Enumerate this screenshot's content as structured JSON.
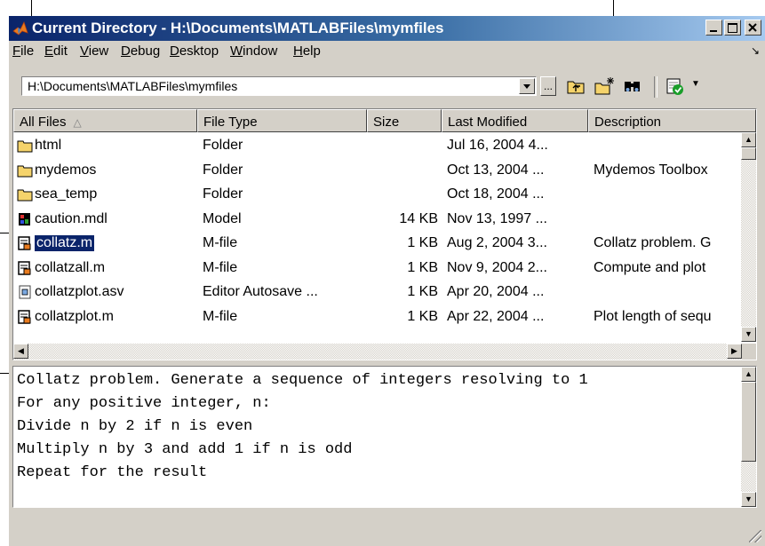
{
  "window": {
    "title": "Current Directory - H:\\Documents\\MATLABFiles\\mymfiles"
  },
  "menu": [
    "File",
    "Edit",
    "View",
    "Debug",
    "Desktop",
    "Window",
    "Help"
  ],
  "toolbar": {
    "path": "H:\\Documents\\MATLABFiles\\mymfiles",
    "browse_label": "...",
    "icons": [
      "up-folder-icon",
      "new-folder-icon",
      "find-files-icon",
      "report-icon"
    ]
  },
  "columns": [
    "All Files",
    "File Type",
    "Size",
    "Last Modified",
    "Description"
  ],
  "files": [
    {
      "name": "html",
      "type": "Folder",
      "size": "",
      "modified": "Jul 16, 2004 4...",
      "description": "",
      "icon": "folder"
    },
    {
      "name": "mydemos",
      "type": "Folder",
      "size": "",
      "modified": "Oct 13, 2004 ...",
      "description": "Mydemos Toolbox",
      "icon": "folder"
    },
    {
      "name": "sea_temp",
      "type": "Folder",
      "size": "",
      "modified": "Oct 18, 2004 ...",
      "description": "",
      "icon": "folder"
    },
    {
      "name": "caution.mdl",
      "type": "Model",
      "size": "14 KB",
      "modified": "Nov 13, 1997 ...",
      "description": "",
      "icon": "model"
    },
    {
      "name": "collatz.m",
      "type": "M-file",
      "size": "1 KB",
      "modified": "Aug 2, 2004 3...",
      "description": "Collatz problem. G",
      "icon": "mfile",
      "selected": true
    },
    {
      "name": "collatzall.m",
      "type": "M-file",
      "size": "1 KB",
      "modified": "Nov 9, 2004 2...",
      "description": "Compute and plot",
      "icon": "mfile"
    },
    {
      "name": "collatzplot.asv",
      "type": "Editor Autosave ...",
      "size": "1 KB",
      "modified": "Apr 20, 2004 ...",
      "description": "",
      "icon": "asv"
    },
    {
      "name": "collatzplot.m",
      "type": "M-file",
      "size": "1 KB",
      "modified": "Apr 22, 2004 ...",
      "description": "Plot length of sequ",
      "icon": "mfile"
    }
  ],
  "description_lines": [
    "Collatz problem. Generate a sequence of integers resolving to 1",
    "For any positive integer, n:",
    "Divide n by 2 if n is even",
    "Multiply n by 3 and add 1 if n is odd",
    "Repeat for the result"
  ],
  "colors": {
    "selection": "#0a246a",
    "folder": "#f5d36b",
    "chrome": "#d4d0c8"
  }
}
